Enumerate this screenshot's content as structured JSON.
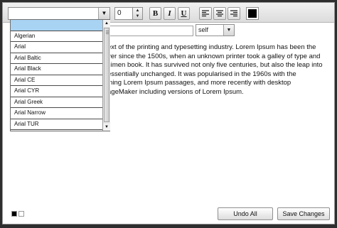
{
  "toolbar": {
    "font_value": "",
    "font_size": "0",
    "bold_label": "B",
    "italic_label": "I",
    "underline_label": "U",
    "text_color": "#000000"
  },
  "link": {
    "url_value": "",
    "target": "self"
  },
  "font_dropdown": {
    "items": [
      "",
      "Algerian",
      "Arial",
      "Arial Baltic",
      "Arial Black",
      "Arial CE",
      "Arial CYR",
      "Arial Greek",
      "Arial Narrow",
      "Arial TUR"
    ],
    "selected_index": 0
  },
  "editor": {
    "lines": [
      "ext of the printing and  typesetting industry. Lorem Ipsum has been the",
      "ver since the 1500s, when an unknown printer took a galley  of type and",
      "cimen book. It has survived  not only five centuries, but also the leap into",
      " essentially unchanged. It was popularised in the 1960s with  the",
      "ining Lorem Ipsum passages, and  more recently with desktop",
      "ageMaker  including versions of Lorem Ipsum."
    ]
  },
  "footer": {
    "undo_label": "Undo All",
    "save_label": "Save Changes",
    "swatches": [
      "#000000",
      "#ffffff"
    ]
  },
  "colors": {
    "selection": "#a9d3f2",
    "background": "#2e2e2e"
  }
}
